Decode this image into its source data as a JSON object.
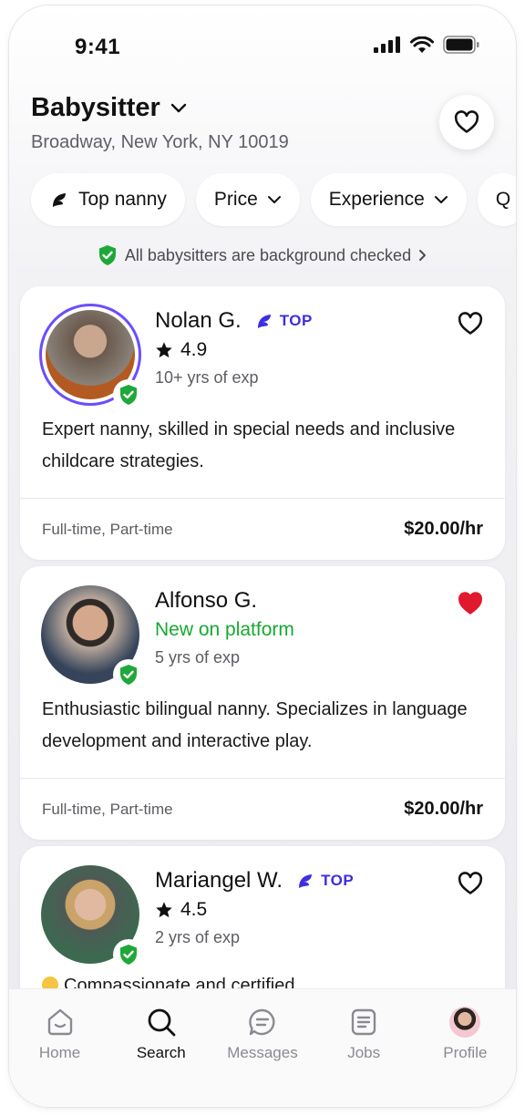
{
  "status": {
    "time": "9:41"
  },
  "header": {
    "category": "Babysitter",
    "location": "Broadway, New York, NY 10019"
  },
  "filters": [
    {
      "label": "Top nanny",
      "icon": "top-nanny-icon"
    },
    {
      "label": "Price"
    },
    {
      "label": "Experience"
    },
    {
      "label": "Q"
    }
  ],
  "notice": {
    "text": "All babysitters are background checked"
  },
  "sitters": [
    {
      "name": "Nolan G.",
      "top": true,
      "top_label": "TOP",
      "rating": "4.9",
      "experience": "10+ yrs of exp",
      "description": "Expert nanny, skilled in special needs and inclusive childcare strategies.",
      "availability": "Full-time, Part-time",
      "rate": "$20.00/hr",
      "favorited": false
    },
    {
      "name": "Alfonso G.",
      "top": false,
      "new_label": "New on platform",
      "experience": "5 yrs of exp",
      "description": "Enthusiastic bilingual nanny. Specializes in language development and interactive play.",
      "availability": "Full-time, Part-time",
      "rate": "$20.00/hr",
      "favorited": true
    },
    {
      "name": "Mariangel W.",
      "top": true,
      "top_label": "TOP",
      "rating": "4.5",
      "experience": "2 yrs of exp",
      "description": "Compassionate and certified",
      "favorited": false
    }
  ],
  "tabs": [
    {
      "label": "Home",
      "icon": "home-icon"
    },
    {
      "label": "Search",
      "icon": "search-icon",
      "active": true
    },
    {
      "label": "Messages",
      "icon": "messages-icon"
    },
    {
      "label": "Jobs",
      "icon": "jobs-icon"
    },
    {
      "label": "Profile",
      "icon": "profile-avatar"
    }
  ],
  "colors": {
    "accent": "#3d2ee0",
    "verified": "#1fa83a",
    "heart_active": "#e0192f",
    "new": "#18a832"
  }
}
